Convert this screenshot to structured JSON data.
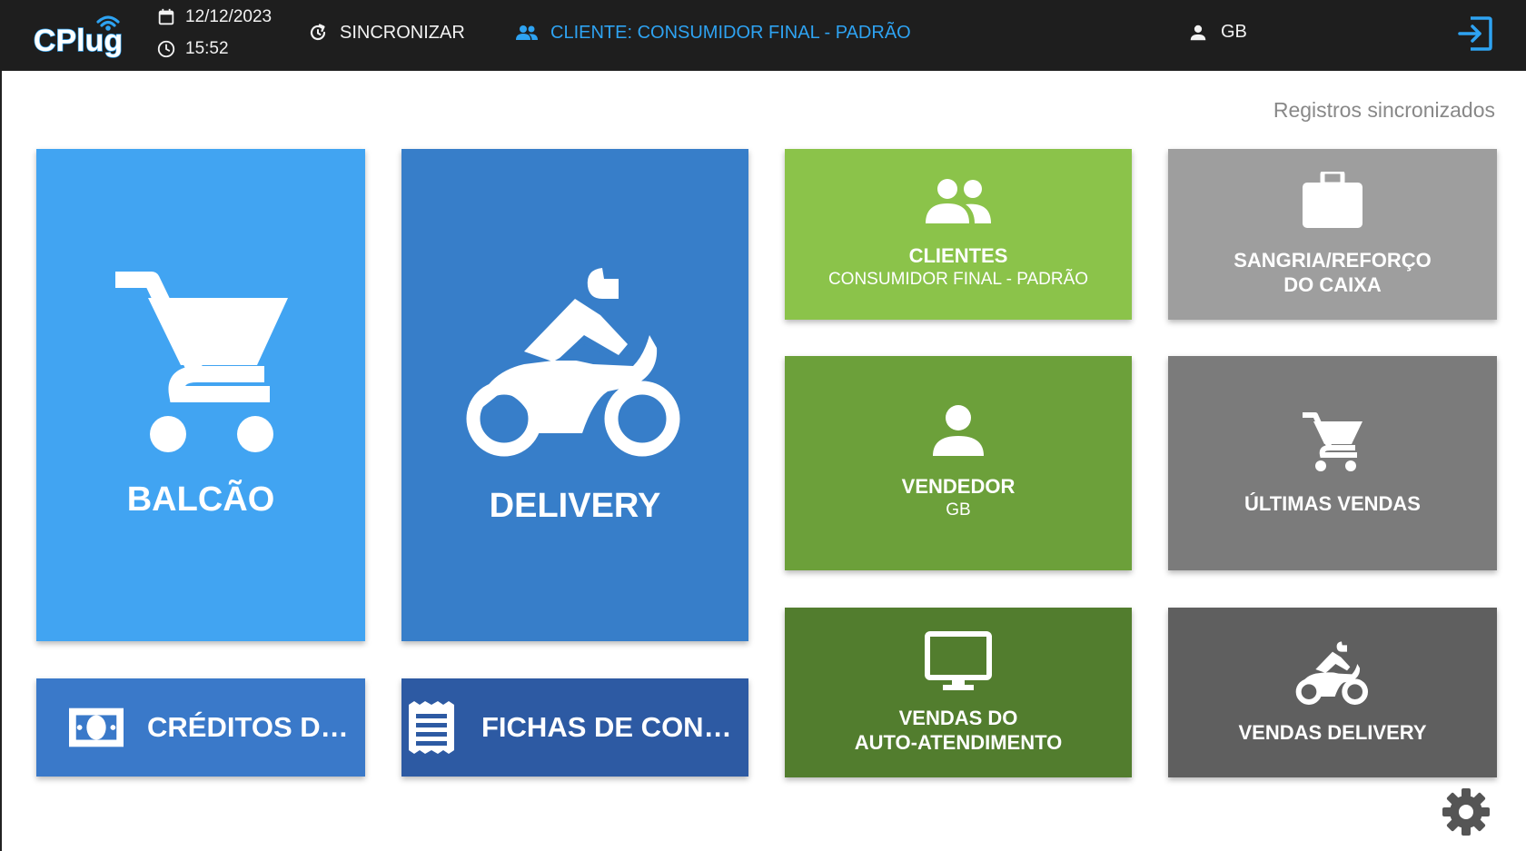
{
  "app": {
    "logo_text": "CPlug",
    "date": "12/12/2023",
    "time": "15:52",
    "sync_label": "SINCRONIZAR",
    "client_label": "CLIENTE: CONSUMIDOR FINAL - PADRÃO",
    "user_label": "GB"
  },
  "status": {
    "text": "Registros sincronizados"
  },
  "tiles": {
    "balcao": {
      "title": "BALCÃO",
      "icon": "cart-icon"
    },
    "delivery": {
      "title": "DELIVERY",
      "icon": "motorcycle-icon"
    },
    "creditos": {
      "title": "CRÉDITOS DOS...",
      "icon": "money-icon"
    },
    "fichas": {
      "title": "FICHAS DE CONS...",
      "icon": "receipt-icon"
    },
    "clientes": {
      "title": "CLIENTES",
      "subtitle": "CONSUMIDOR FINAL - PADRÃO",
      "icon": "people-icon"
    },
    "vendedor": {
      "title": "VENDEDOR",
      "subtitle": "GB",
      "icon": "person-icon"
    },
    "autoatendimento": {
      "title_line1": "VENDAS DO",
      "title_line2": "AUTO-ATENDIMENTO",
      "icon": "monitor-icon"
    },
    "sangria": {
      "title_line1": "SANGRIA/REFORÇO",
      "title_line2": "DO CAIXA",
      "icon": "briefcase-icon"
    },
    "ultimas": {
      "title": "ÚLTIMAS VENDAS",
      "icon": "cart-icon"
    },
    "vendas_delivery": {
      "title": "VENDAS DELIVERY",
      "icon": "motorcycle-icon"
    }
  },
  "colors": {
    "topbar": "#1e1e1e",
    "accent": "#2ea3f2",
    "balcao": "#41a4f2",
    "delivery": "#377ec9",
    "creditos": "#3a79c9",
    "fichas": "#2d5aa3",
    "clientes": "#8bc34a",
    "vendedor": "#6ca03a",
    "autoatendimento": "#527d2e",
    "sangria": "#9e9e9e",
    "ultimas": "#7b7b7b",
    "vendas_delivery": "#5f5f5f"
  }
}
